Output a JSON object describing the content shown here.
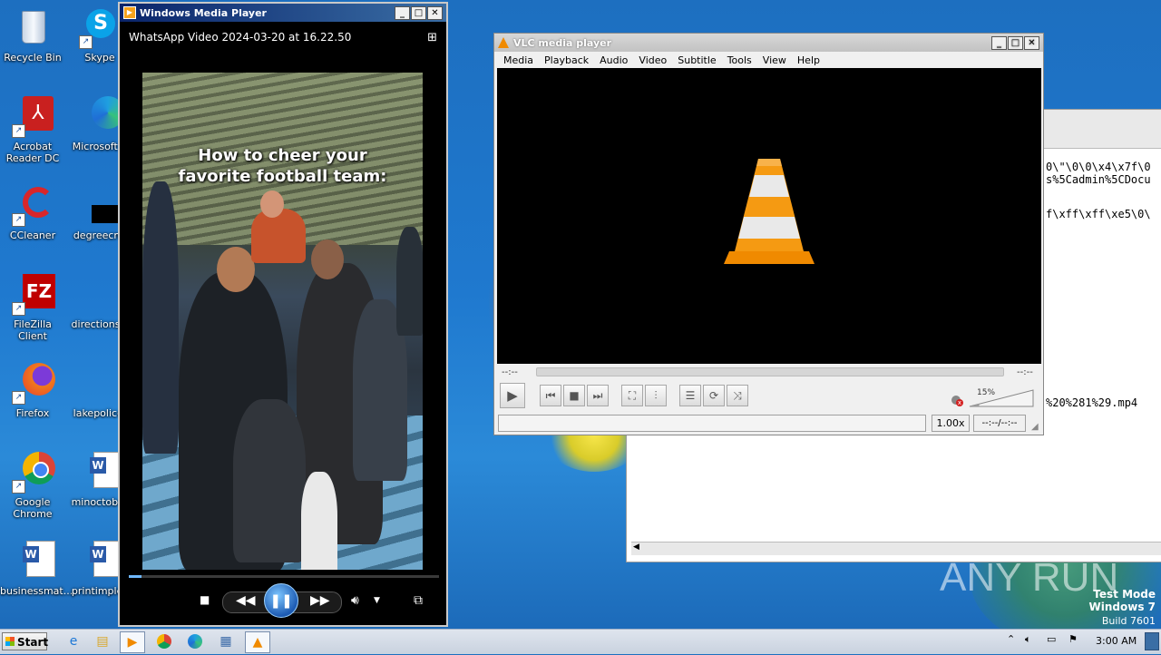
{
  "desktop": {
    "icons": [
      {
        "label": "Recycle Bin",
        "icon": "recycle-bin-icon"
      },
      {
        "label": "Skype",
        "icon": "skype-icon"
      },
      {
        "label": "Acrobat Reader DC",
        "icon": "acrobat-icon"
      },
      {
        "label": "Microsoft E",
        "icon": "edge-icon"
      },
      {
        "label": "CCleaner",
        "icon": "ccleaner-icon"
      },
      {
        "label": "degreecne",
        "icon": "file-icon"
      },
      {
        "label": "FileZilla Client",
        "icon": "filezilla-icon"
      },
      {
        "label": "directionsw",
        "icon": "file-icon"
      },
      {
        "label": "Firefox",
        "icon": "firefox-icon"
      },
      {
        "label": "lakepolice.",
        "icon": "file-icon"
      },
      {
        "label": "Google Chrome",
        "icon": "chrome-icon"
      },
      {
        "label": "minoctober",
        "icon": "word-doc-icon"
      },
      {
        "label": "businessmat...",
        "icon": "word-doc-icon"
      },
      {
        "label": "printimples",
        "icon": "word-doc-icon"
      }
    ]
  },
  "wmp": {
    "title": "Windows Media Player",
    "media_title": "WhatsApp Video 2024-03-20 at 16.22.50",
    "caption_line1": "How to cheer your",
    "caption_line2": "favorite football team:",
    "progress_fraction": 0.04
  },
  "vlc": {
    "title": "VLC media player",
    "menu": [
      "Media",
      "Playback",
      "Audio",
      "Video",
      "Subtitle",
      "Tools",
      "View",
      "Help"
    ],
    "elapsed": "--:--",
    "remaining": "--:--",
    "volume": "15%",
    "speed": "1.00x",
    "total_time": "--:--/--:--"
  },
  "background_window": {
    "lines": [
      "0\\\"\\0\\0\\x4\\x7f\\0",
      "s%5Cadmin%5CDocu",
      "f\\xff\\xff\\xe5\\0\\",
      "%20%281%29.mp4"
    ]
  },
  "watermark": {
    "brand": "ANY RUN",
    "mode": "Test Mode",
    "os": "Windows 7",
    "build": "Build 7601"
  },
  "taskbar": {
    "start_label": "Start",
    "clock": "3:00 AM"
  }
}
